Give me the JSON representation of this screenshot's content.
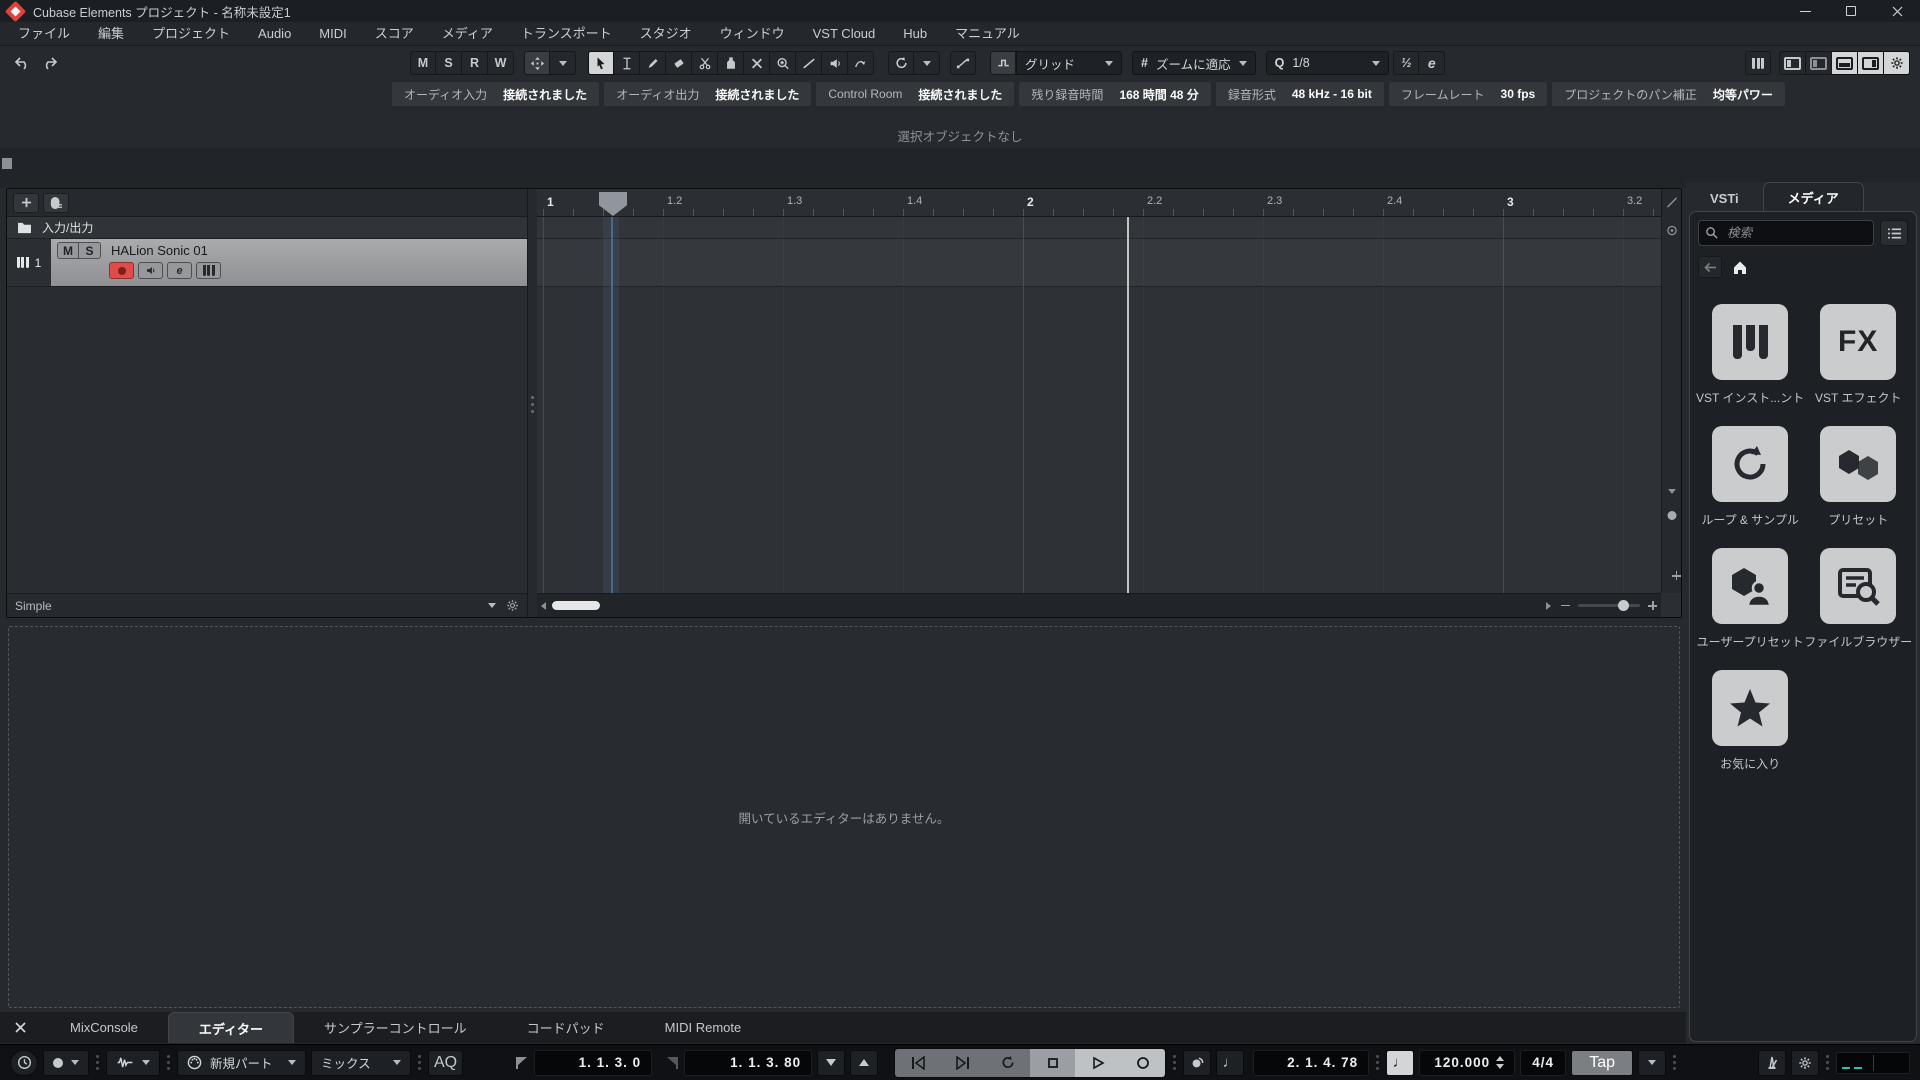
{
  "titlebar": {
    "title": "Cubase Elements プロジェクト - 名称未設定1"
  },
  "menubar": {
    "items": [
      "ファイル",
      "編集",
      "プロジェクト",
      "Audio",
      "MIDI",
      "スコア",
      "メディア",
      "トランスポート",
      "スタジオ",
      "ウィンドウ",
      "VST Cloud",
      "Hub",
      "マニュアル"
    ]
  },
  "toolbar": {
    "msrw": [
      "M",
      "S",
      "R",
      "W"
    ],
    "grid_mode": "グリッド",
    "grid_type": "ズームに適応",
    "hash": "#",
    "q": "Q",
    "quantize": "1/8",
    "swing": "½",
    "edit": "e"
  },
  "infoline": {
    "pairs": [
      {
        "label": "オーディオ入力",
        "value": "接続されました"
      },
      {
        "label": "オーディオ出力",
        "value": "接続されました"
      },
      {
        "label": "Control Room",
        "value": "接続されました"
      },
      {
        "label": "残り録音時間",
        "value": "168 時間 48 分"
      },
      {
        "label": "録音形式",
        "value": "48 kHz - 16 bit"
      },
      {
        "label": "フレームレート",
        "value": "30 fps"
      },
      {
        "label": "プロジェクトのパン補正",
        "value": "均等パワー"
      }
    ]
  },
  "statusline": {
    "text": "選択オブジェクトなし"
  },
  "track_panel": {
    "io_label": "入力/出力",
    "track": {
      "number": "1",
      "mute": "M",
      "solo": "S",
      "name": "HALion Sonic 01",
      "edit": "e"
    },
    "footer": "Simple"
  },
  "ruler": {
    "ticks": [
      "1",
      "1.2",
      "1.3",
      "1.4",
      "2",
      "2.2",
      "2.3",
      "2.4",
      "3",
      "3.2"
    ]
  },
  "lower_zone": {
    "message": "開いているエディターはありません。",
    "tabs": [
      {
        "label": "MixConsole"
      },
      {
        "label": "エディター"
      },
      {
        "label": "サンプラーコントロール"
      },
      {
        "label": "コードパッド"
      },
      {
        "label": "MIDI Remote"
      }
    ]
  },
  "right_zone": {
    "tabs": [
      {
        "label": "VSTi"
      },
      {
        "label": "メディア"
      }
    ],
    "search_placeholder": "検索",
    "tiles": [
      {
        "label": "VST インスト...ント"
      },
      {
        "label": "VST エフェクト",
        "glyph": "FX"
      },
      {
        "label": "ループ & サンプル"
      },
      {
        "label": "プリセット"
      },
      {
        "label": "ユーザープリセット"
      },
      {
        "label": "ファイルブラウザー"
      },
      {
        "label": "お気に入り"
      }
    ]
  },
  "transport": {
    "part_mode": "新規パート",
    "mix_mode": "ミックス",
    "aq": "AQ",
    "left_locator": "1. 1. 3. 0",
    "right_locator": "1. 1. 3. 80",
    "position": "2. 1. 4. 78",
    "tempo": "120.000",
    "time_sig": "4/4",
    "tap": "Tap"
  }
}
